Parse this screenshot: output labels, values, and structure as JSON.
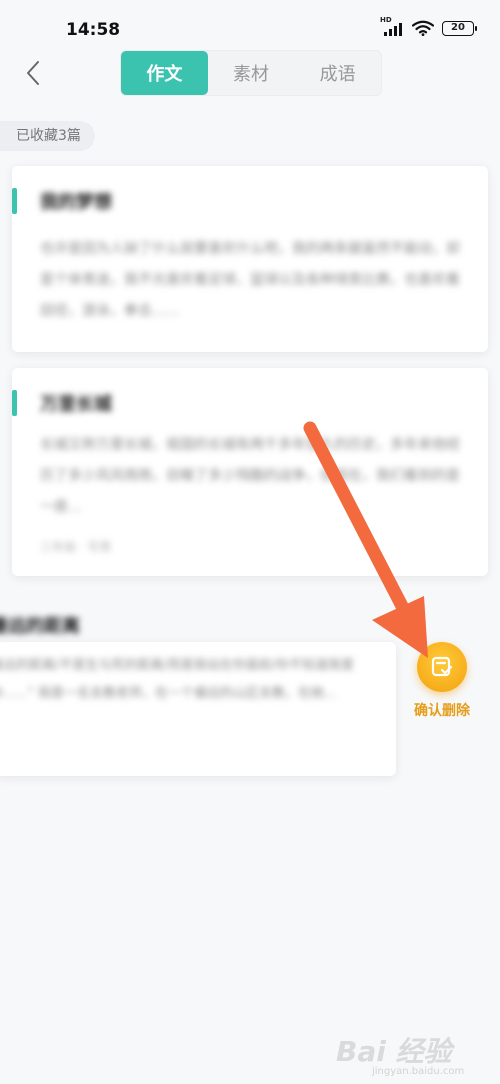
{
  "status": {
    "time": "14:58",
    "network_label": "HD",
    "battery": "20"
  },
  "nav": {
    "back_icon": "chevron-left-icon",
    "tabs": [
      {
        "label": "作文",
        "active": true
      },
      {
        "label": "素材",
        "active": false
      },
      {
        "label": "成语",
        "active": false
      }
    ]
  },
  "saved_count": "已收藏3篇",
  "cards": [
    {
      "title": "我的梦想",
      "excerpt": "也许是因为人缺了什么就要喜欢什么吧，我的两条腿虽然不能动，却是个体育迷，我不光喜欢看足球，篮球以及各种球类比赛，也喜欢看田径，游泳，拳击......"
    },
    {
      "title": "万里长城",
      "excerpt": "长城又称万里长城，祖国的长城有两千多年悠久的历史，多年来他经历了多少风风雨雨，目睹了多少残酷的战争，但现在，我们看到的是一座...",
      "meta": "三年级 · 写景"
    },
    {
      "title": "最远的距离",
      "excerpt": "最远的距离/不是生与死的距离/而是我站在你面前/你不知道我爱你......\" 我是一名支教老师，在一个偏远的山区支教，在她..."
    }
  ],
  "confirm": {
    "label": "确认删除",
    "icon": "confirm-delete-icon",
    "color": "#f3a10f"
  },
  "annotation": {
    "arrow_color": "#f26a3d"
  },
  "watermark": {
    "main": "Bai 经验",
    "sub": "jingyan.baidu.com"
  },
  "colors": {
    "accent": "#3cc3b0"
  }
}
